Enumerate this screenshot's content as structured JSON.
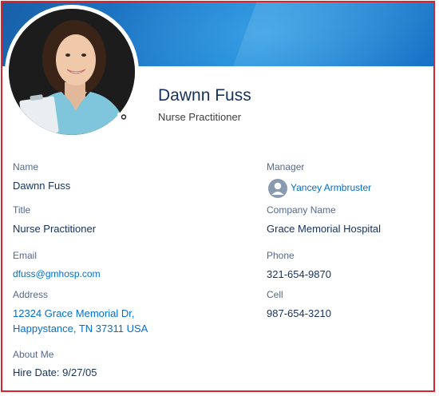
{
  "profile": {
    "name": "Dawnn Fuss",
    "title": "Nurse Practitioner"
  },
  "fields": {
    "name_label": "Name",
    "name_value": "Dawnn Fuss",
    "manager_label": "Manager",
    "manager_value": "Yancey Armbruster",
    "title_label": "Title",
    "title_value": "Nurse Practitioner",
    "company_label": "Company Name",
    "company_value": "Grace Memorial Hospital",
    "email_label": "Email",
    "email_value": "dfuss@gmhosp.com",
    "phone_label": "Phone",
    "phone_value": "321-654-9870",
    "address_label": "Address",
    "address_line1": "12324 Grace Memorial Dr,",
    "address_line2": "Happystance, TN 37311 USA",
    "cell_label": "Cell",
    "cell_value": "987-654-3210",
    "about_label": "About Me",
    "about_value": "Hire Date: 9/27/05"
  },
  "icons": {
    "camera": "camera-icon",
    "manager_avatar": "user-icon"
  },
  "colors": {
    "frame": "#d9232e",
    "banner": "#1d7ac9",
    "link": "#0070d2",
    "label": "#54698d",
    "value": "#16325c"
  }
}
